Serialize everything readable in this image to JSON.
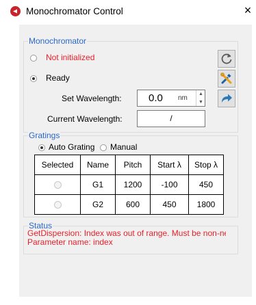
{
  "window": {
    "title": "Monochromator Control",
    "close_label": "×"
  },
  "monochromator": {
    "group_label": "Monochromator",
    "status_options": [
      {
        "label": "Not initialized",
        "selected": false,
        "color": "#e8202a"
      },
      {
        "label": "Ready",
        "selected": true,
        "color": "#000000"
      }
    ],
    "set_wavelength_label": "Set Wavelength:",
    "set_wavelength_value": "0.0",
    "set_wavelength_unit": "nm",
    "current_wavelength_label": "Current Wavelength:",
    "current_wavelength_value": "/",
    "buttons": [
      {
        "icon": "refresh-icon"
      },
      {
        "icon": "tools-icon"
      },
      {
        "icon": "share-arrow-icon"
      }
    ]
  },
  "gratings": {
    "group_label": "Gratings",
    "mode_auto_label": "Auto Grating",
    "mode_manual_label": "Manual",
    "columns": [
      "Selected",
      "Name",
      "Pitch",
      "Start λ",
      "Stop λ"
    ],
    "rows": [
      {
        "name": "G1",
        "pitch": "1200",
        "start": "-100",
        "stop": "450"
      },
      {
        "name": "G2",
        "pitch": "600",
        "start": "450",
        "stop": "1800"
      }
    ]
  },
  "status": {
    "group_label": "Status",
    "lines": [
      "GetDispersion: Index was out of range. Must be non-neg",
      "Parameter name: index"
    ]
  }
}
